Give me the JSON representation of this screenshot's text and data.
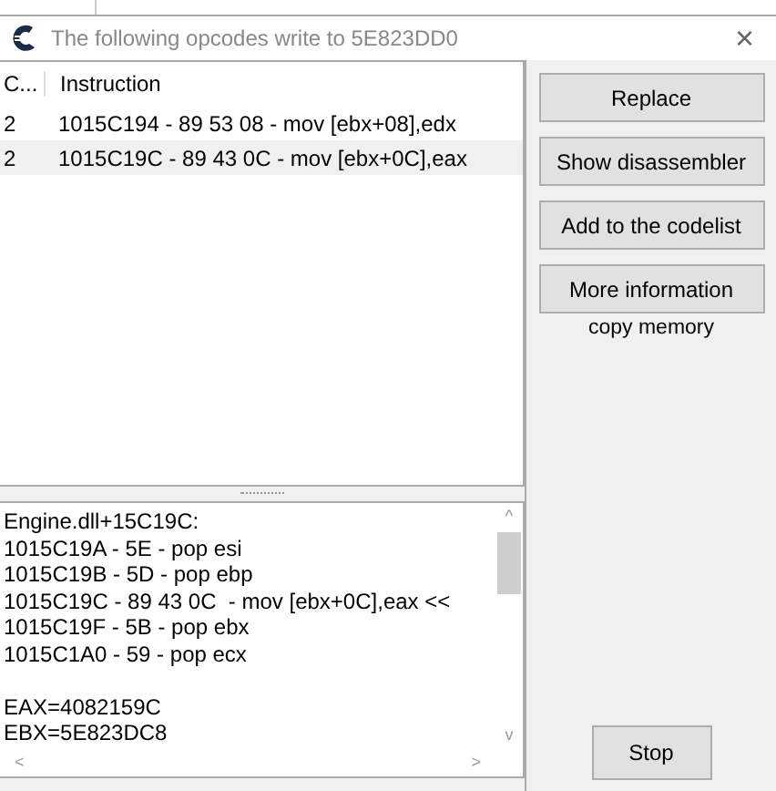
{
  "window": {
    "title": "The following opcodes write to 5E823DD0",
    "close": "×"
  },
  "table": {
    "columns": [
      "C...",
      "Instruction"
    ],
    "rows": [
      {
        "cells": [
          "2",
          "1015C194 - 89 53 08  - mov [ebx+08],edx"
        ],
        "selected": false
      },
      {
        "cells": [
          "2",
          "1015C19C - 89 43 0C  - mov [ebx+0C],eax"
        ],
        "selected": true
      }
    ]
  },
  "details": {
    "lines": [
      "Engine.dll+15C19C:",
      "1015C19A - 5E - pop esi",
      "1015C19B - 5D - pop ebp",
      "1015C19C - 89 43 0C  - mov [ebx+0C],eax <<",
      "1015C19F - 5B - pop ebx",
      "1015C1A0 - 59 - pop ecx"
    ],
    "registers": [
      "EAX=4082159C",
      "EBX=5E823DC8"
    ],
    "scroll_up": "^",
    "scroll_down": "v",
    "scroll_left": "<",
    "scroll_right": ">"
  },
  "buttons": [
    "Replace",
    "Show disassembler",
    "Add to the codelist",
    "More information"
  ],
  "copy_memory": "copy memory",
  "stop": "Stop"
}
